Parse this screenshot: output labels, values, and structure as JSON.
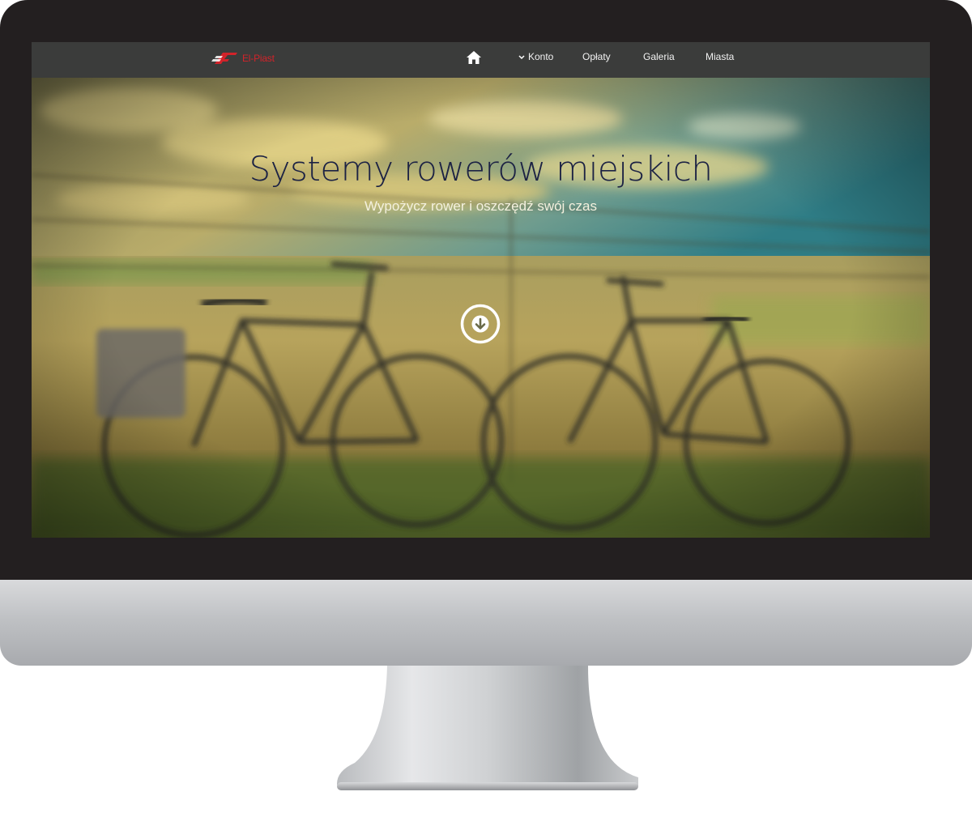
{
  "brand": {
    "name": "El-Piast",
    "color": "#d2232a"
  },
  "nav": {
    "home_icon": "home-icon",
    "items": [
      {
        "label": "Konto",
        "icon": "chevron-down-icon"
      },
      {
        "label": "Opłaty"
      },
      {
        "label": "Galeria"
      },
      {
        "label": "Miasta"
      }
    ]
  },
  "hero": {
    "title": "Systemy rowerów miejskich",
    "subtitle": "Wypożycz rower i oszczędź swój czas",
    "scroll_icon": "arrow-down-circle-icon"
  },
  "colors": {
    "navbar": "#3b3c3b",
    "title": "#1c2244",
    "bezel": "#231f20"
  }
}
